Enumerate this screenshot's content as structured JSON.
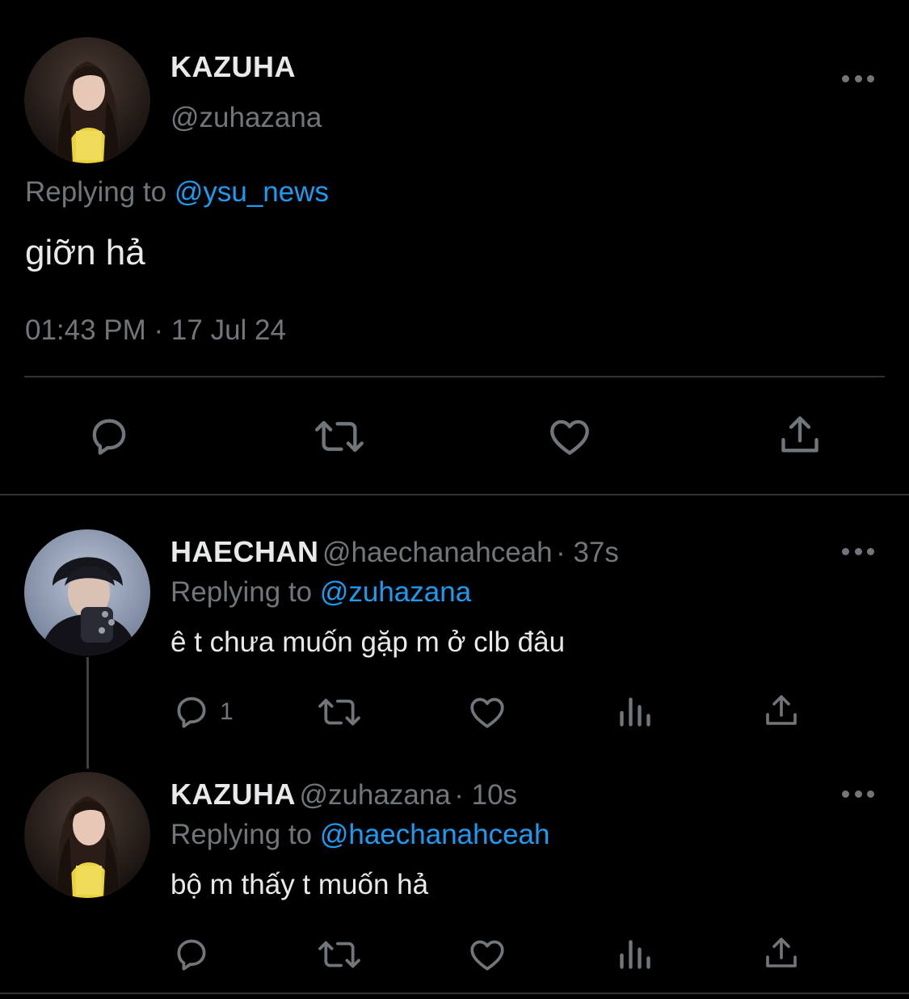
{
  "main_tweet": {
    "display_name": "KAZUHA",
    "handle": "@zuhazana",
    "replying_prefix": "Replying to",
    "replying_handle": "@ysu_news",
    "text": "giỡn hả",
    "timestamp": "01:43 PM · 17 Jul 24"
  },
  "replies": [
    {
      "display_name": "HAECHAN",
      "handle": "@haechanahceah",
      "time": "· 37s",
      "replying_prefix": "Replying to",
      "replying_handle": "@zuhazana",
      "text": "ê t chưa muốn gặp m ở clb đâu",
      "reply_count": "1"
    },
    {
      "display_name": "KAZUHA",
      "handle": "@zuhazana",
      "time": "· 10s",
      "replying_prefix": "Replying to",
      "replying_handle": "@haechanahceah",
      "text": "bộ m thấy t muốn hả",
      "reply_count": ""
    }
  ],
  "icons": [
    "more-icon",
    "reply-icon",
    "retweet-icon",
    "like-icon",
    "views-icon",
    "share-icon"
  ],
  "colors": {
    "background": "#000000",
    "text": "#e7e9ea",
    "secondary": "#71767b",
    "link": "#1d9bf0",
    "divider": "#2f3336"
  }
}
